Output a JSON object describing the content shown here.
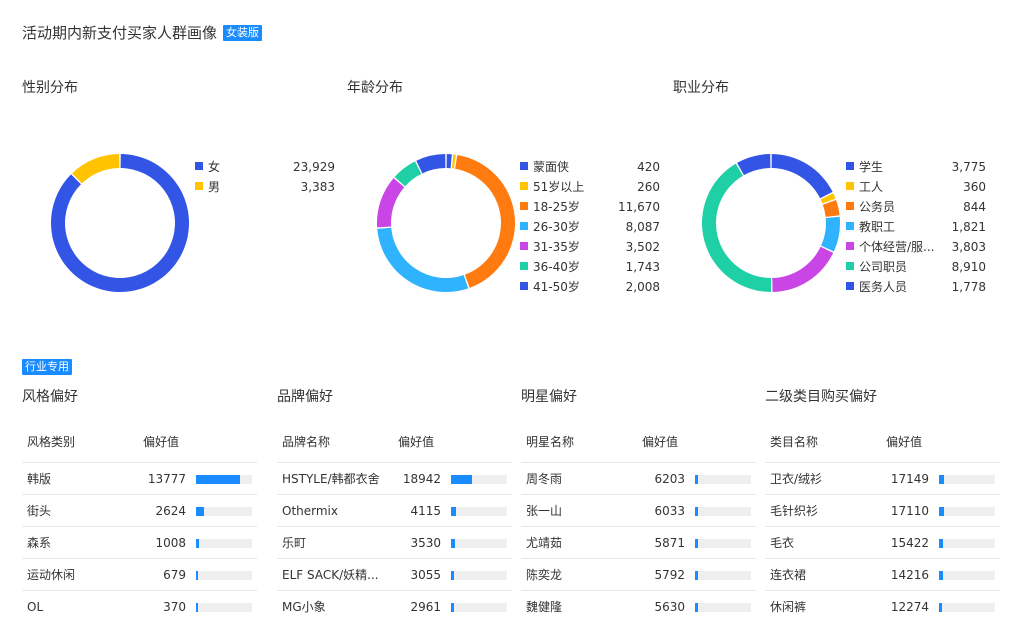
{
  "page": {
    "title": "活动期内新支付买家人群画像",
    "badge": "女装版",
    "industry_badge": "行业专用"
  },
  "chart_data": [
    {
      "type": "pie",
      "title": "性别分布",
      "legend": "right",
      "slices": [
        {
          "label": "女",
          "value": 23929,
          "value_label": "23,929",
          "color": "#3355e6"
        },
        {
          "label": "男",
          "value": 3383,
          "value_label": "3,383",
          "color": "#ffc300"
        }
      ]
    },
    {
      "type": "pie",
      "title": "年龄分布",
      "legend": "right",
      "slices": [
        {
          "label": "蒙面侠",
          "value": 420,
          "value_label": "420",
          "color": "#3355e6"
        },
        {
          "label": "51岁以上",
          "value": 260,
          "value_label": "260",
          "color": "#ffc300"
        },
        {
          "label": "18-25岁",
          "value": 11670,
          "value_label": "11,670",
          "color": "#ff7a0f"
        },
        {
          "label": "26-30岁",
          "value": 8087,
          "value_label": "8,087",
          "color": "#2fb3ff"
        },
        {
          "label": "31-35岁",
          "value": 3502,
          "value_label": "3,502",
          "color": "#c945e6"
        },
        {
          "label": "36-40岁",
          "value": 1743,
          "value_label": "1,743",
          "color": "#1fcfa5"
        },
        {
          "label": "41-50岁",
          "value": 2008,
          "value_label": "2,008",
          "color": "#3355e6"
        }
      ]
    },
    {
      "type": "pie",
      "title": "职业分布",
      "legend": "right",
      "slices": [
        {
          "label": "学生",
          "value": 3775,
          "value_label": "3,775",
          "color": "#3355e6"
        },
        {
          "label": "工人",
          "value": 360,
          "value_label": "360",
          "color": "#ffc300"
        },
        {
          "label": "公务员",
          "value": 844,
          "value_label": "844",
          "color": "#ff7a0f"
        },
        {
          "label": "教职工",
          "value": 1821,
          "value_label": "1,821",
          "color": "#2fb3ff"
        },
        {
          "label": "个体经营/服...",
          "value": 3803,
          "value_label": "3,803",
          "color": "#c945e6"
        },
        {
          "label": "公司职员",
          "value": 8910,
          "value_label": "8,910",
          "color": "#1fcfa5"
        },
        {
          "label": "医务人员",
          "value": 1778,
          "value_label": "1,778",
          "color": "#3355e6"
        }
      ]
    },
    {
      "type": "table",
      "title": "风格偏好",
      "columns": [
        "风格类别",
        "偏好值"
      ],
      "max": 17500,
      "rows": [
        {
          "name": "韩版",
          "value": 13777
        },
        {
          "name": "街头",
          "value": 2624
        },
        {
          "name": "森系",
          "value": 1008
        },
        {
          "name": "运动休闲",
          "value": 679
        },
        {
          "name": "OL",
          "value": 370
        }
      ]
    },
    {
      "type": "table",
      "title": "品牌偏好",
      "columns": [
        "品牌名称",
        "偏好值"
      ],
      "max": 50000,
      "rows": [
        {
          "name": "HSTYLE/韩都衣舍",
          "value": 18942
        },
        {
          "name": "Othermix",
          "value": 4115
        },
        {
          "name": "乐町",
          "value": 3530
        },
        {
          "name": "ELF SACK/妖精...",
          "value": 3055
        },
        {
          "name": "MG小象",
          "value": 2961
        }
      ]
    },
    {
      "type": "table",
      "title": "明星偏好",
      "columns": [
        "明星名称",
        "偏好值"
      ],
      "max": 100000,
      "rows": [
        {
          "name": "周冬雨",
          "value": 6203
        },
        {
          "name": "张一山",
          "value": 6033
        },
        {
          "name": "尤靖茹",
          "value": 5871
        },
        {
          "name": "陈奕龙",
          "value": 5792
        },
        {
          "name": "魏健隆",
          "value": 5630
        }
      ]
    },
    {
      "type": "table",
      "title": "二级类目购买偏好",
      "columns": [
        "类目名称",
        "偏好值"
      ],
      "max": 200000,
      "rows": [
        {
          "name": "卫衣/绒衫",
          "value": 17149
        },
        {
          "name": "毛针织衫",
          "value": 17110
        },
        {
          "name": "毛衣",
          "value": 15422
        },
        {
          "name": "连衣裙",
          "value": 14216
        },
        {
          "name": "休闲裤",
          "value": 12274
        }
      ]
    }
  ]
}
